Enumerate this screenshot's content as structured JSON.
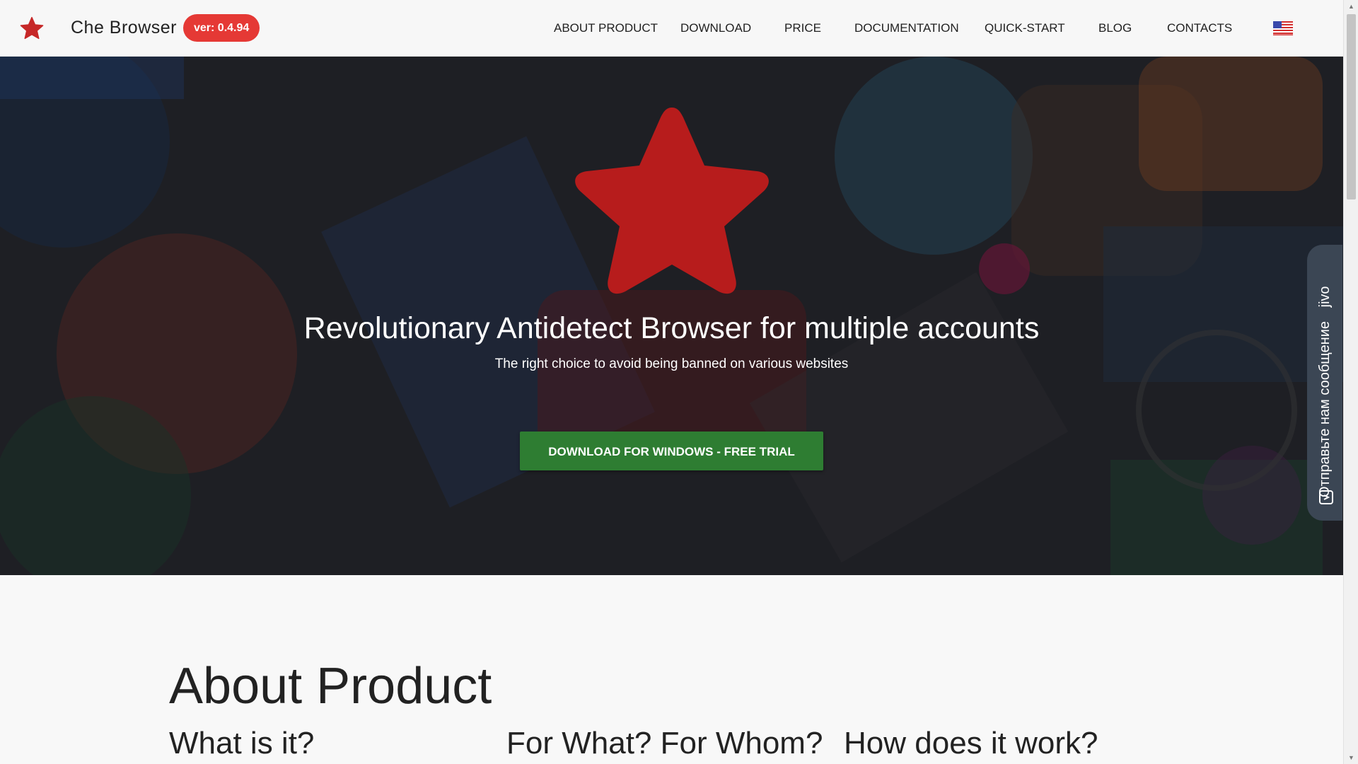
{
  "header": {
    "brand": "Che Browser",
    "version": "ver: 0.4.94",
    "nav": [
      {
        "label": "ABOUT PRODUCT"
      },
      {
        "label": "DOWNLOAD"
      },
      {
        "label": "PRICE"
      },
      {
        "label": "DOCUMENTATION"
      },
      {
        "label": "QUICK-START"
      },
      {
        "label": "BLOG"
      },
      {
        "label": "CONTACTS"
      }
    ],
    "language_icon": "us-flag-icon"
  },
  "hero": {
    "title": "Revolutionary Antidetect Browser for multiple accounts",
    "subtitle": "The right choice to avoid being banned on various websites",
    "cta": "DOWNLOAD FOR WINDOWS - FREE TRIAL"
  },
  "chat_widget": {
    "label": "Отправьте нам сообщение",
    "brand": "jivo"
  },
  "about": {
    "title": "About Product",
    "columns": [
      {
        "heading": "What is it?"
      },
      {
        "heading": "For What? For Whom?"
      },
      {
        "heading": "How does it work?"
      }
    ]
  },
  "colors": {
    "accent_red": "#e53935",
    "star_red": "#b71c1c",
    "cta_green": "#2e7d32",
    "jivo_tab": "#3b4654"
  }
}
